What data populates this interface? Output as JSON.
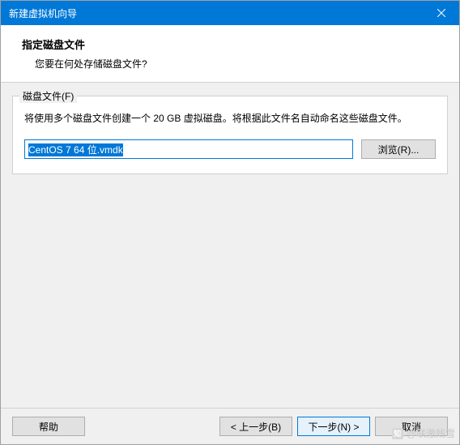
{
  "window": {
    "title": "新建虚拟机向导"
  },
  "header": {
    "title": "指定磁盘文件",
    "subtitle": "您要在何处存储磁盘文件?"
  },
  "fieldset": {
    "legend": "磁盘文件(F)",
    "description": "将使用多个磁盘文件创建一个 20 GB 虚拟磁盘。将根据此文件名自动命名这些磁盘文件。",
    "input_value": "CentOS 7 64 位.vmdk",
    "browse_label": "浏览(R)..."
  },
  "footer": {
    "help": "帮助",
    "back": "< 上一步(B)",
    "next": "下一步(N) >",
    "cancel": "取消"
  },
  "watermark": {
    "icon": "知",
    "text": "@联澈残雪"
  }
}
